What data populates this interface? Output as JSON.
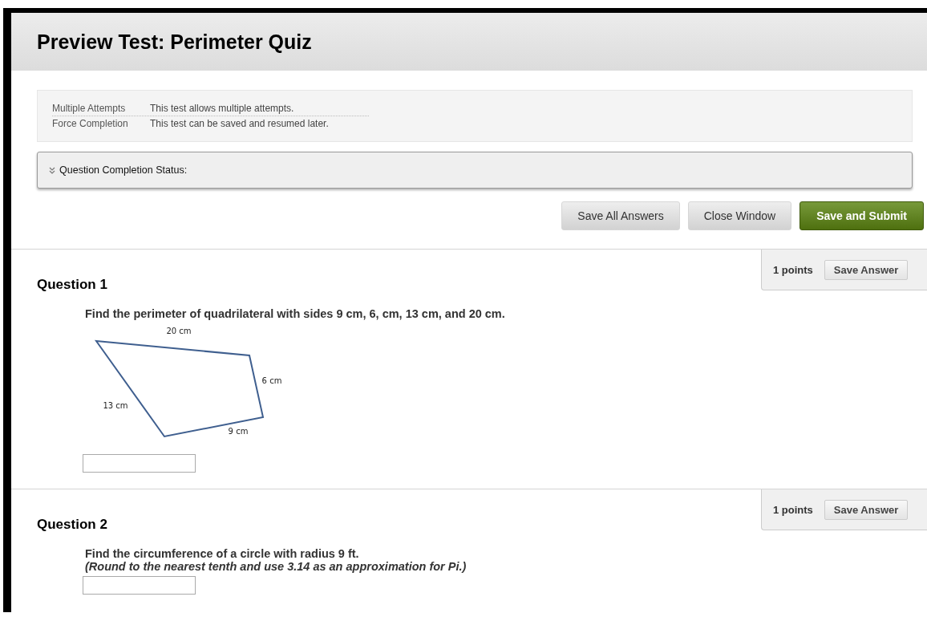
{
  "header": {
    "title": "Preview Test: Perimeter Quiz"
  },
  "instructions": [
    {
      "label": "Multiple Attempts",
      "value": "This test allows multiple attempts."
    },
    {
      "label": "Force Completion",
      "value": "This test can be saved and resumed later."
    }
  ],
  "completion_status": {
    "label": "Question Completion Status:",
    "expanded": false
  },
  "actions": [
    {
      "label": "Save All Answers",
      "kind": "secondary"
    },
    {
      "label": "Close Window",
      "kind": "secondary"
    },
    {
      "label": "Save and Submit",
      "kind": "primary"
    }
  ],
  "questions": [
    {
      "title": "Question 1",
      "points": "1 points",
      "save_button": "Save Answer",
      "prompt": "Find the perimeter of quadrilateral with sides 9 cm, 6, cm, 13 cm, and 20 cm.",
      "figure": {
        "kind": "quadrilateral",
        "side_labels": [
          "20 cm",
          "6 cm",
          "9 cm",
          "13 cm"
        ]
      }
    },
    {
      "title": "Question 2",
      "points": "1 points",
      "save_button": "Save Answer",
      "prompt": "Find the circumference of a circle with radius 9 ft.",
      "note": "(Round to the nearest tenth and use 3.14 as an approximation for Pi.)"
    }
  ]
}
